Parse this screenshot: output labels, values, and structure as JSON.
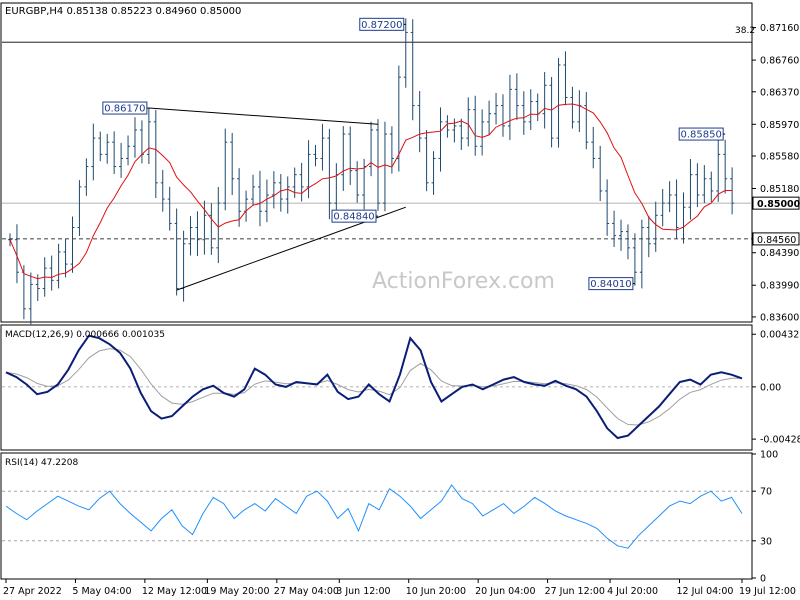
{
  "chart_data": [
    {
      "type": "candlestick",
      "symbol_label": "EURGBP,H4",
      "ohlc_label": "0.85138 0.85223 0.84960 0.85000",
      "ylim": [
        0.8355,
        0.8745
      ],
      "y_ticks": [
        "0.87160",
        "0.86760",
        "0.86370",
        "0.85970",
        "0.85580",
        "0.85180",
        "0.84390",
        "0.83990",
        "0.83600"
      ],
      "y_tick_values": [
        0.8716,
        0.8676,
        0.8637,
        0.8597,
        0.8558,
        0.8518,
        0.8439,
        0.8399,
        0.836
      ],
      "current_price_label": "0.85000",
      "current_price": 0.85,
      "support_label": "0.84560",
      "support_price": 0.8456,
      "fib_label": "38.2",
      "fib_price": 0.8698,
      "annotations": [
        {
          "label": "0.87200",
          "price": 0.872,
          "date_index": 57
        },
        {
          "label": "0.86170",
          "price": 0.8617,
          "date_index": 20
        },
        {
          "label": "0.84840",
          "price": 0.8484,
          "date_index": 53
        },
        {
          "label": "0.84010",
          "price": 0.8401,
          "date_index": 90
        },
        {
          "label": "0.85850",
          "price": 0.8585,
          "date_index": 103
        }
      ],
      "trendlines": [
        {
          "from": [
            20,
            0.8617
          ],
          "to": [
            53,
            0.8597
          ]
        },
        {
          "from": [
            24,
            0.8393
          ],
          "to": [
            57,
            0.8495
          ]
        }
      ],
      "watermark": "ActionForex.com",
      "price_series": [
        [
          0,
          0.8455
        ],
        [
          1,
          0.8415
        ],
        [
          2,
          0.837
        ],
        [
          3,
          0.84
        ],
        [
          4,
          0.8395
        ],
        [
          5,
          0.842
        ],
        [
          6,
          0.8405
        ],
        [
          7,
          0.844
        ],
        [
          8,
          0.8425
        ],
        [
          9,
          0.847
        ],
        [
          10,
          0.852
        ],
        [
          11,
          0.8545
        ],
        [
          12,
          0.858
        ],
        [
          13,
          0.856
        ],
        [
          14,
          0.8575
        ],
        [
          15,
          0.8545
        ],
        [
          16,
          0.8555
        ],
        [
          17,
          0.857
        ],
        [
          18,
          0.859
        ],
        [
          19,
          0.856
        ],
        [
          20,
          0.86
        ],
        [
          21,
          0.8525
        ],
        [
          22,
          0.8505
        ],
        [
          23,
          0.8475
        ],
        [
          24,
          0.8395
        ],
        [
          25,
          0.845
        ],
        [
          26,
          0.847
        ],
        [
          27,
          0.8455
        ],
        [
          28,
          0.8485
        ],
        [
          29,
          0.8445
        ],
        [
          30,
          0.85
        ],
        [
          31,
          0.8575
        ],
        [
          32,
          0.853
        ],
        [
          33,
          0.849
        ],
        [
          34,
          0.8505
        ],
        [
          35,
          0.852
        ],
        [
          36,
          0.849
        ],
        [
          37,
          0.851
        ],
        [
          38,
          0.8525
        ],
        [
          39,
          0.8505
        ],
        [
          40,
          0.852
        ],
        [
          41,
          0.8535
        ],
        [
          42,
          0.852
        ],
        [
          43,
          0.856
        ],
        [
          44,
          0.8555
        ],
        [
          45,
          0.858
        ],
        [
          46,
          0.85
        ],
        [
          47,
          0.8535
        ],
        [
          48,
          0.8585
        ],
        [
          49,
          0.854
        ],
        [
          50,
          0.851
        ],
        [
          51,
          0.8545
        ],
        [
          52,
          0.859
        ],
        [
          53,
          0.85
        ],
        [
          54,
          0.8585
        ],
        [
          55,
          0.8555
        ],
        [
          56,
          0.8655
        ],
        [
          57,
          0.871
        ],
        [
          58,
          0.862
        ],
        [
          59,
          0.858
        ],
        [
          60,
          0.8525
        ],
        [
          61,
          0.8555
        ],
        [
          62,
          0.86
        ],
        [
          63,
          0.859
        ],
        [
          64,
          0.8595
        ],
        [
          65,
          0.858
        ],
        [
          66,
          0.8615
        ],
        [
          67,
          0.857
        ],
        [
          68,
          0.86
        ],
        [
          69,
          0.861
        ],
        [
          70,
          0.862
        ],
        [
          71,
          0.8595
        ],
        [
          72,
          0.864
        ],
        [
          73,
          0.862
        ],
        [
          74,
          0.86
        ],
        [
          75,
          0.8625
        ],
        [
          76,
          0.861
        ],
        [
          77,
          0.8645
        ],
        [
          78,
          0.858
        ],
        [
          79,
          0.867
        ],
        [
          80,
          0.863
        ],
        [
          81,
          0.86
        ],
        [
          82,
          0.862
        ],
        [
          83,
          0.8575
        ],
        [
          84,
          0.8555
        ],
        [
          85,
          0.8515
        ],
        [
          86,
          0.8475
        ],
        [
          87,
          0.846
        ],
        [
          88,
          0.8465
        ],
        [
          89,
          0.8445
        ],
        [
          90,
          0.8415
        ],
        [
          91,
          0.847
        ],
        [
          92,
          0.845
        ],
        [
          93,
          0.8485
        ],
        [
          94,
          0.85
        ],
        [
          95,
          0.851
        ],
        [
          96,
          0.847
        ],
        [
          97,
          0.8495
        ],
        [
          98,
          0.8535
        ],
        [
          99,
          0.851
        ],
        [
          100,
          0.853
        ],
        [
          101,
          0.8515
        ],
        [
          102,
          0.856
        ],
        [
          103,
          0.853
        ],
        [
          104,
          0.85
        ]
      ],
      "x_tick_labels": [
        "27 Apr 2022",
        "5 May 04:00",
        "12 May 12:00",
        "19 May 20:00",
        "27 May 04:00",
        "3 Jun 12:00",
        "10 Jun 20:00",
        "20 Jun 04:00",
        "27 Jun 12:00",
        "4 Jul 20:00",
        "12 Jul 04:00",
        "19 Jul 12:00"
      ],
      "x_tick_index": [
        0,
        10,
        20,
        29,
        39,
        48,
        58,
        68,
        78,
        87,
        97,
        106
      ]
    },
    {
      "type": "line",
      "label": "MACD(12,26,9) 0.000666 0.001035",
      "ylim": [
        -0.0051,
        0.005
      ],
      "y_ticks": [
        "0.004325",
        "0.00",
        "-0.004288"
      ],
      "y_tick_values": [
        0.004325,
        0.0,
        -0.004288
      ],
      "series": [
        {
          "name": "MACD",
          "values": [
            0.0012,
            0.0008,
            0.0002,
            -0.0006,
            -0.0004,
            0.0002,
            0.0014,
            0.003,
            0.0042,
            0.004,
            0.0035,
            0.0028,
            0.0015,
            -0.0005,
            -0.002,
            -0.0026,
            -0.0024,
            -0.0016,
            -0.0008,
            -0.0002,
            0.0001,
            -0.0005,
            -0.0008,
            -0.0002,
            0.0015,
            0.001,
            0.0002,
            0.0,
            0.0004,
            0.0003,
            0.0002,
            0.001,
            -0.0004,
            -0.001,
            -0.0008,
            0.0002,
            -0.0006,
            -0.0012,
            0.001,
            0.004,
            0.003,
            0.0004,
            -0.0012,
            -0.0006,
            0.0,
            0.0002,
            -0.0002,
            0.0002,
            0.0006,
            0.0008,
            0.0004,
            0.0002,
            0.0001,
            0.0005,
            0.0001,
            -0.0002,
            -0.0008,
            -0.002,
            -0.0034,
            -0.0042,
            -0.004,
            -0.0032,
            -0.0024,
            -0.0016,
            -0.0006,
            0.0004,
            0.0006,
            0.0002,
            0.001,
            0.0012,
            0.001,
            0.0007
          ]
        }
      ]
    },
    {
      "type": "line",
      "label": "RSI(14) 47.2208",
      "ylim": [
        0,
        100
      ],
      "y_ticks": [
        "100",
        "70",
        "30",
        "0"
      ],
      "y_tick_values": [
        100,
        70,
        30,
        0
      ],
      "series": [
        {
          "name": "RSI",
          "values": [
            58,
            52,
            47,
            54,
            60,
            66,
            62,
            58,
            55,
            64,
            70,
            60,
            52,
            45,
            38,
            48,
            55,
            42,
            35,
            52,
            65,
            60,
            48,
            55,
            60,
            54,
            64,
            58,
            52,
            66,
            70,
            62,
            48,
            56,
            38,
            60,
            55,
            72,
            66,
            58,
            48,
            55,
            62,
            75,
            64,
            60,
            50,
            55,
            60,
            52,
            58,
            65,
            60,
            54,
            50,
            47,
            44,
            40,
            32,
            26,
            24,
            34,
            42,
            50,
            58,
            62,
            60,
            66,
            70,
            62,
            65,
            52
          ]
        }
      ]
    }
  ]
}
